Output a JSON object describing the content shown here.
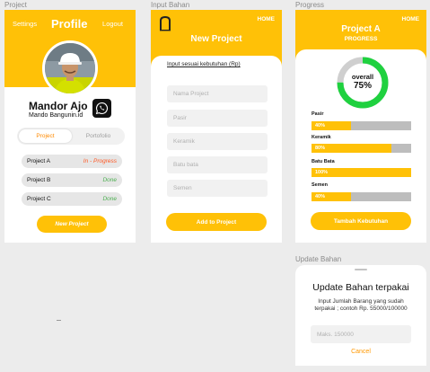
{
  "frames": {
    "profile": "Project",
    "input": "Input Bahan",
    "progress": "Progress",
    "update": "Update Bahan"
  },
  "profile": {
    "settings": "Settings",
    "title": "Profile",
    "logout": "Logout",
    "name": "Mandor Ajo",
    "subtitle": "Mando Bangunin.id",
    "tabs": [
      "Project",
      "Portofolio"
    ],
    "projects": [
      {
        "name": "Project A",
        "status": "In - Progress",
        "color": "#ff5722"
      },
      {
        "name": "Project B",
        "status": "Done",
        "color": "#4caf50"
      },
      {
        "name": "Project C",
        "status": "Done",
        "color": "#4caf50"
      }
    ],
    "new_project_button": "New Project"
  },
  "input_bahan": {
    "home": "HOME",
    "title": "New Project",
    "subtitle": "Input sesuai kebutuhan (Rp)",
    "fields": [
      "Nama Project",
      "Pasir",
      "Keramik",
      "Batu bata",
      "Semen"
    ],
    "add_button": "Add to Project"
  },
  "progress": {
    "home": "HOME",
    "title": "Project A",
    "subtitle": "PROGRESS",
    "overall_label": "overall",
    "overall_value": "75%",
    "overall_fraction": 0.75,
    "materials": [
      {
        "label": "Pasir",
        "value": "40%",
        "fraction": 0.4
      },
      {
        "label": "Keramik",
        "value": "80%",
        "fraction": 0.8
      },
      {
        "label": "Batu Bata",
        "value": "100%",
        "fraction": 1.0
      },
      {
        "label": "Semen",
        "value": "40%",
        "fraction": 0.4
      }
    ],
    "add_button": "Tambah Kebutuhan"
  },
  "update_bahan": {
    "title": "Update Bahan terpakai",
    "description": "Input Jumlah Barang yang sudah terpakai ; contoh Rp. 55000/100000",
    "placeholder": "Maks. 150000",
    "cancel": "Cancel"
  },
  "colors": {
    "accent": "#ffc107",
    "progress_ring": "#1fd13f",
    "ring_track": "#cfcfcf",
    "bar_track": "#bdbdbd",
    "cancel": "#ff9800"
  }
}
